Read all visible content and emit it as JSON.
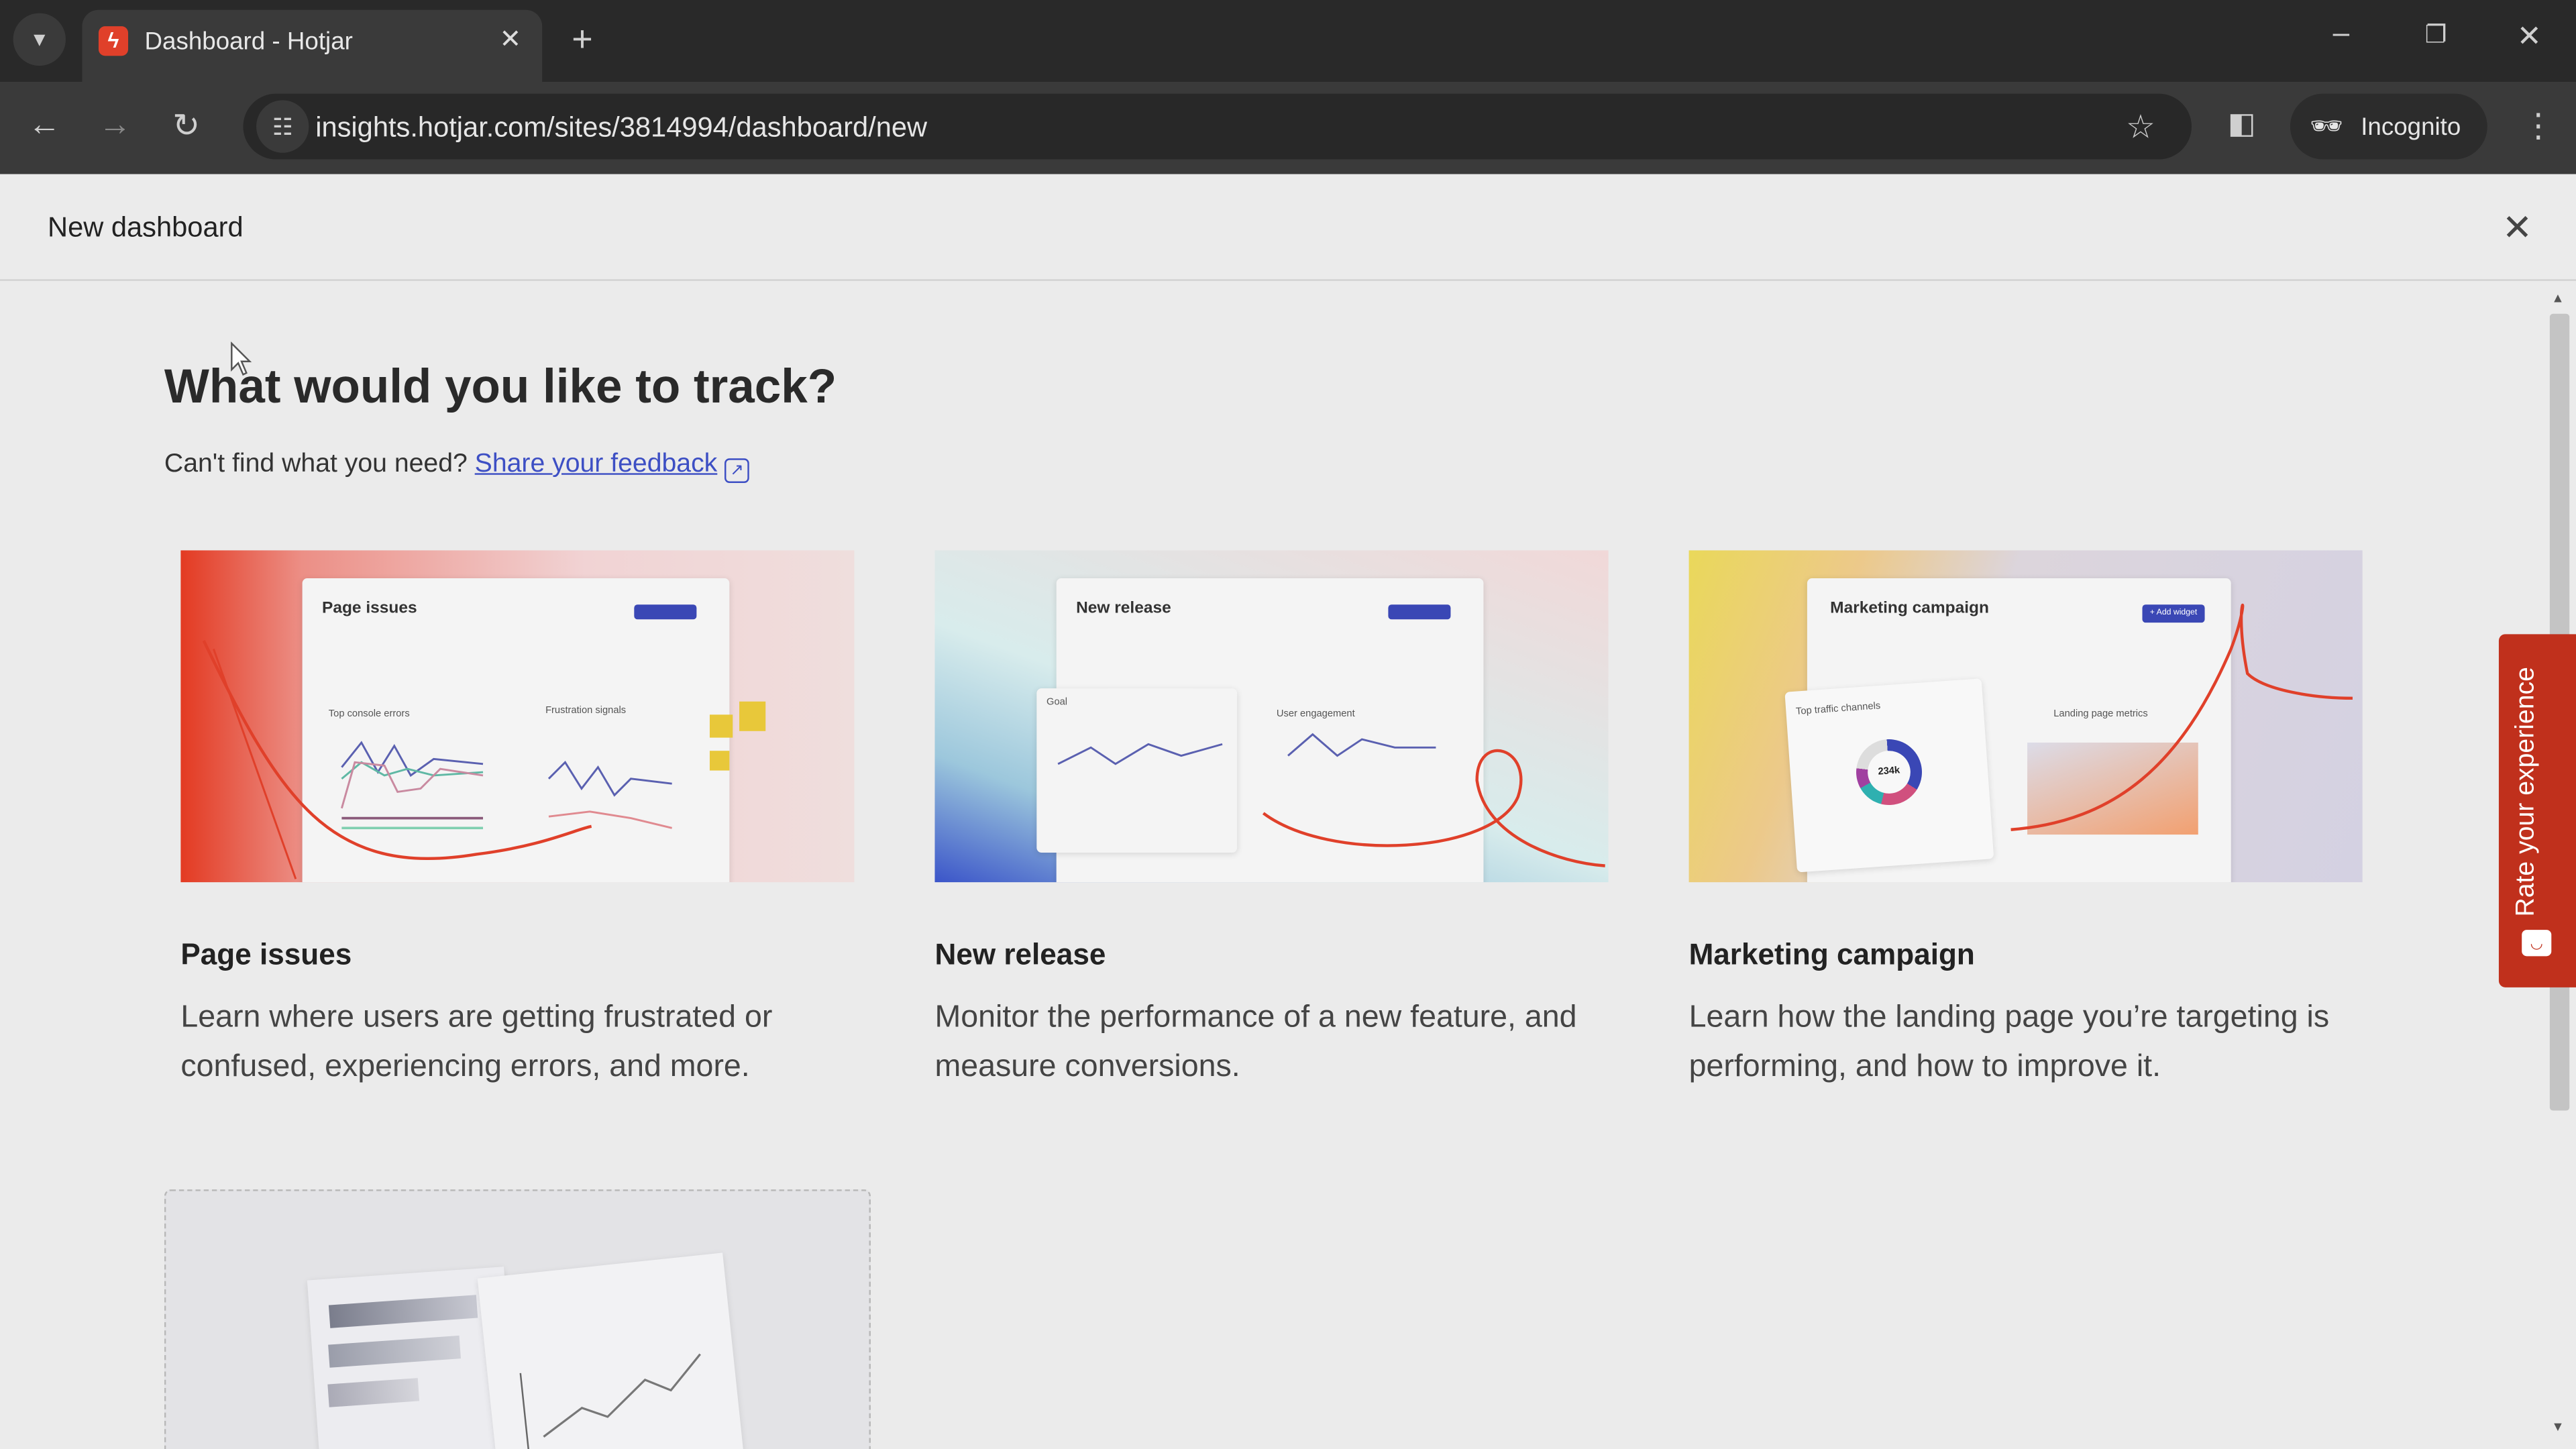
{
  "browser": {
    "tab_title": "Dashboard - Hotjar",
    "url": "insights.hotjar.com/sites/3814994/dashboard/new",
    "incognito_label": "Incognito"
  },
  "modal": {
    "title": "New dashboard",
    "heading": "What would you like to track?",
    "prompt": "Can't find what you need?",
    "feedback_link": "Share your feedback"
  },
  "templates": [
    {
      "title": "Page issues",
      "description": "Learn where users are getting frustrated or confused, experiencing errors, and more.",
      "image_title": "Page issues",
      "image_widgets": [
        "Top console errors",
        "Frustration signals"
      ],
      "gradient": [
        "#e33a22",
        "#f0c9cf"
      ]
    },
    {
      "title": "New release",
      "description": "Monitor the performance of a new feature, and measure conversions.",
      "image_title": "New release",
      "image_widgets": [
        "Goal",
        "User engagement"
      ],
      "gradient": [
        "#3b55c9",
        "#a8dcdc"
      ]
    },
    {
      "title": "Marketing campaign",
      "description": "Learn how the landing page you’re targeting is performing, and how to improve it.",
      "image_title": "Marketing campaign",
      "image_widgets": [
        "Top traffic channels",
        "Landing page metrics"
      ],
      "image_value": "234k",
      "image_button": "+ Add widget",
      "gradient": [
        "#e9d95a",
        "#d4d1e2"
      ]
    }
  ],
  "feedback_tab": {
    "label": "Rate your experience",
    "color": "#c0301c"
  },
  "accent_color": "#3d4fc4"
}
